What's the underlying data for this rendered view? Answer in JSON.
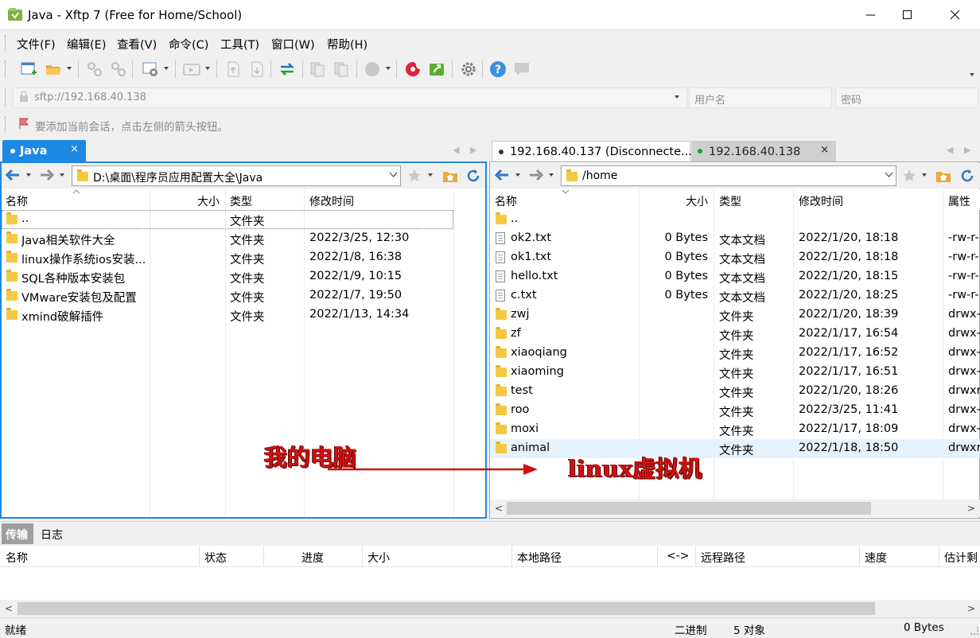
{
  "window": {
    "title": "Java - Xftp 7 (Free for Home/School)"
  },
  "menu": [
    "文件(F)",
    "编辑(E)",
    "查看(V)",
    "命令(C)",
    "工具(T)",
    "窗口(W)",
    "帮助(H)"
  ],
  "address": {
    "host": "sftp://192.168.40.138",
    "username_placeholder": "用户名",
    "password_placeholder": "密码"
  },
  "hint": "要添加当前会话，点击左侧的箭头按钮。",
  "left": {
    "tab": "Java",
    "path": "D:\\桌面\\程序员应用配置大全\\Java",
    "columns": [
      "名称",
      "大小",
      "类型",
      "修改时间"
    ],
    "rows": [
      {
        "name": "..",
        "size": "",
        "type": "文件夹",
        "modified": ""
      },
      {
        "name": "Java相关软件大全",
        "size": "",
        "type": "文件夹",
        "modified": "2022/3/25, 12:30"
      },
      {
        "name": "linux操作系统ios安装...",
        "size": "",
        "type": "文件夹",
        "modified": "2022/1/8, 16:38"
      },
      {
        "name": "SQL各种版本安装包",
        "size": "",
        "type": "文件夹",
        "modified": "2022/1/9, 10:15"
      },
      {
        "name": "VMware安装包及配置",
        "size": "",
        "type": "文件夹",
        "modified": "2022/1/7, 19:50"
      },
      {
        "name": "xmind破解插件",
        "size": "",
        "type": "文件夹",
        "modified": "2022/1/13, 14:34"
      }
    ]
  },
  "right": {
    "tabs": [
      {
        "label": "192.168.40.137 (Disconnecte...",
        "status": "disconnected"
      },
      {
        "label": "192.168.40.138",
        "status": "connected"
      }
    ],
    "path": "/home",
    "columns": [
      "名称",
      "大小",
      "类型",
      "修改时间",
      "属性"
    ],
    "rows": [
      {
        "name": "..",
        "size": "",
        "type": "",
        "modified": "",
        "attr": "",
        "kind": "folder"
      },
      {
        "name": "ok2.txt",
        "size": "0 Bytes",
        "type": "文本文档",
        "modified": "2022/1/20, 18:18",
        "attr": "-rw-r-",
        "kind": "file"
      },
      {
        "name": "ok1.txt",
        "size": "0 Bytes",
        "type": "文本文档",
        "modified": "2022/1/20, 18:18",
        "attr": "-rw-r-",
        "kind": "file"
      },
      {
        "name": "hello.txt",
        "size": "0 Bytes",
        "type": "文本文档",
        "modified": "2022/1/20, 18:15",
        "attr": "-rw-r-",
        "kind": "file"
      },
      {
        "name": "c.txt",
        "size": "0 Bytes",
        "type": "文本文档",
        "modified": "2022/1/20, 18:25",
        "attr": "-rw-r-",
        "kind": "file"
      },
      {
        "name": "zwj",
        "size": "",
        "type": "文件夹",
        "modified": "2022/1/20, 18:39",
        "attr": "drwx-",
        "kind": "folder"
      },
      {
        "name": "zf",
        "size": "",
        "type": "文件夹",
        "modified": "2022/1/17, 16:54",
        "attr": "drwx-",
        "kind": "folder"
      },
      {
        "name": "xiaoqiang",
        "size": "",
        "type": "文件夹",
        "modified": "2022/1/17, 16:52",
        "attr": "drwx-",
        "kind": "folder"
      },
      {
        "name": "xiaoming",
        "size": "",
        "type": "文件夹",
        "modified": "2022/1/17, 16:51",
        "attr": "drwx-",
        "kind": "folder"
      },
      {
        "name": "test",
        "size": "",
        "type": "文件夹",
        "modified": "2022/1/20, 18:26",
        "attr": "drwxr",
        "kind": "folder"
      },
      {
        "name": "roo",
        "size": "",
        "type": "文件夹",
        "modified": "2022/3/25, 11:41",
        "attr": "drwx-",
        "kind": "folder"
      },
      {
        "name": "moxi",
        "size": "",
        "type": "文件夹",
        "modified": "2022/1/17, 18:09",
        "attr": "drwx-",
        "kind": "folder"
      },
      {
        "name": "animal",
        "size": "",
        "type": "文件夹",
        "modified": "2022/1/18, 18:50",
        "attr": "drwxr",
        "kind": "folder"
      }
    ]
  },
  "annotations": {
    "left_label": "我的电脑",
    "right_label": "linux虚拟机",
    "color": "#d01010"
  },
  "transfer": {
    "tabs": [
      "传输",
      "日志"
    ],
    "columns": [
      "名称",
      "状态",
      "进度",
      "大小",
      "本地路径",
      "<->",
      "远程路径",
      "速度",
      "估计剩"
    ]
  },
  "status": {
    "left": "就绪",
    "mode": "二进制",
    "objects": "5 对象",
    "size": "0 Bytes"
  },
  "colors": {
    "accent": "#1e88e5",
    "selected_row": "#e5f3ff",
    "connected": "#1aa31a"
  }
}
